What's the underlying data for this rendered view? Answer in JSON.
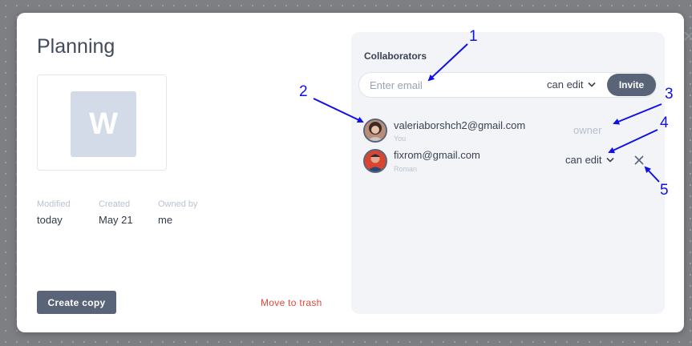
{
  "modal": {
    "title": "Planning",
    "thumbnail_letter": "W",
    "meta": {
      "modified_label": "Modified",
      "modified_value": "today",
      "created_label": "Created",
      "created_value": "May 21",
      "owned_label": "Owned by",
      "owned_value": "me"
    },
    "create_copy_label": "Create copy",
    "move_to_trash_label": "Move to trash"
  },
  "collaborators": {
    "title": "Collaborators",
    "email_placeholder": "Enter email",
    "email_value": "",
    "invite_permission": "can edit",
    "invite_label": "Invite",
    "rows": [
      {
        "email": "valeriaborshch2@gmail.com",
        "subtitle": "You",
        "role": "owner"
      },
      {
        "email": "fixrom@gmail.com",
        "subtitle": "Roman",
        "permission": "can edit"
      }
    ]
  },
  "annotations": [
    "1",
    "2",
    "3",
    "4",
    "5"
  ],
  "colors": {
    "primary_button": "#5a6478",
    "danger_text": "#e2473c",
    "annotation": "#1010e8",
    "panel_bg": "#f3f4f7"
  },
  "icons": [
    "close-icon",
    "chevron-down-icon",
    "remove-icon",
    "avatar"
  ]
}
